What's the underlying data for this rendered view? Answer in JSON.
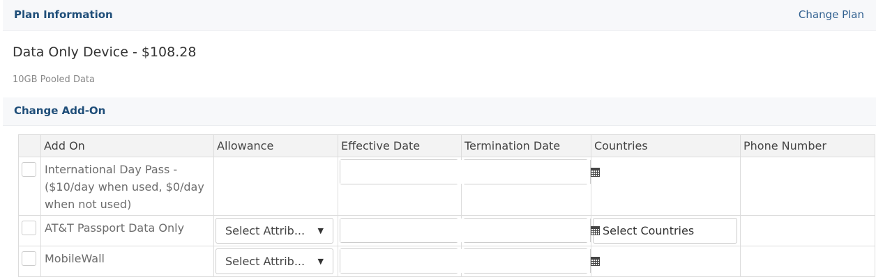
{
  "plan_header": {
    "title": "Plan Information",
    "change_plan": "Change Plan"
  },
  "plan": {
    "name": "Data Only Device - $108.28",
    "description": "10GB Pooled Data"
  },
  "addon_header": {
    "title": "Change Add-On"
  },
  "table": {
    "columns": [
      "",
      "Add On",
      "Allowance",
      "Effective Date",
      "Termination Date",
      "Countries",
      "Phone Number"
    ],
    "rows": [
      {
        "name": "International Day Pass - ($10/day when used, $0/day when not used)",
        "allowance": "",
        "countries": "",
        "phone": ""
      },
      {
        "name": "AT&T Passport Data Only",
        "allowance": "Select Attrib...",
        "countries": "Select Countries",
        "phone": ""
      },
      {
        "name": "MobileWall",
        "allowance": "Select Attrib...",
        "countries": "",
        "phone": ""
      }
    ]
  },
  "icons": {
    "calendar": "calendar-icon",
    "dropdown": "caret-down-icon"
  }
}
